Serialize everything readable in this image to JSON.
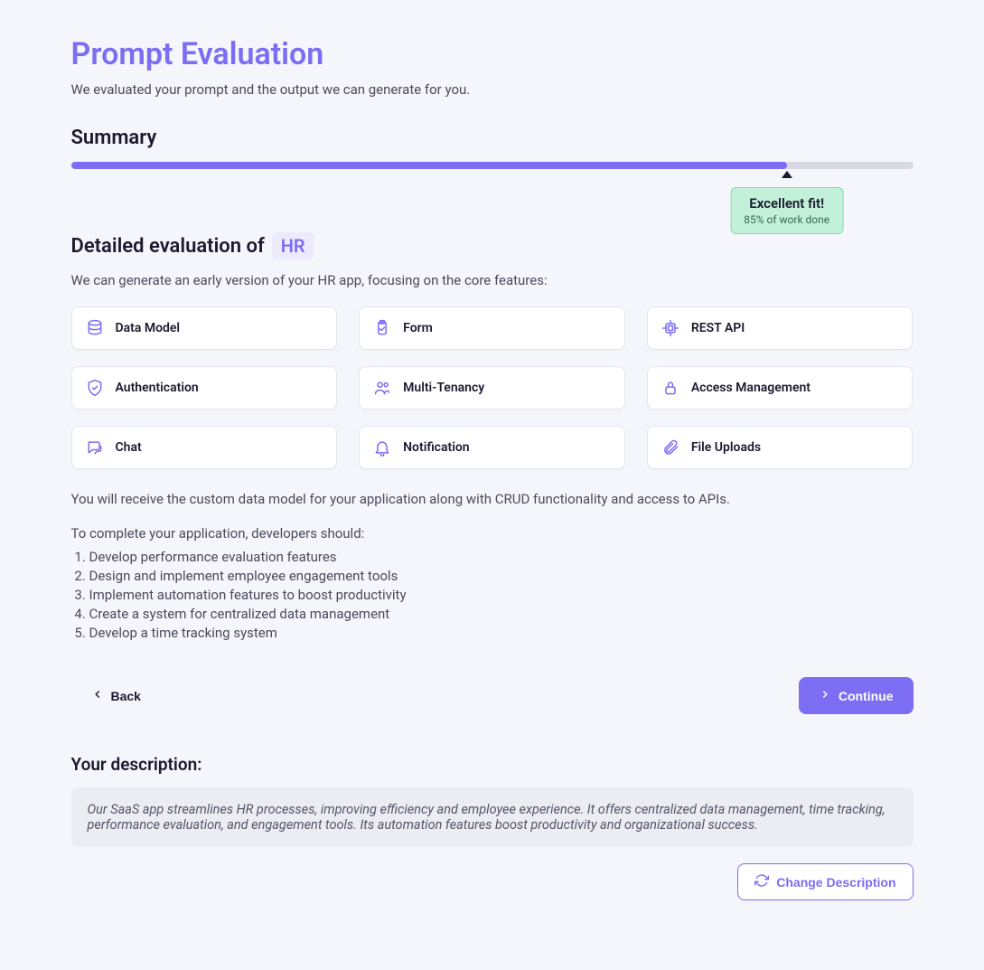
{
  "header": {
    "title": "Prompt Evaluation",
    "subtitle": "We evaluated your prompt and the output we can generate for you."
  },
  "summary": {
    "heading": "Summary",
    "progress_percent": 85,
    "badge_title": "Excellent fit!",
    "badge_sub": "85% of work done"
  },
  "detail": {
    "heading_prefix": "Detailed evaluation of",
    "chip": "HR",
    "intro": "We can generate an early version of your HR app, focusing on the core features:",
    "features": [
      {
        "icon": "database",
        "label": "Data Model"
      },
      {
        "icon": "clipboard",
        "label": "Form"
      },
      {
        "icon": "cpu",
        "label": "REST API"
      },
      {
        "icon": "shield",
        "label": "Authentication"
      },
      {
        "icon": "users",
        "label": "Multi-Tenancy"
      },
      {
        "icon": "lock",
        "label": "Access Management"
      },
      {
        "icon": "chat",
        "label": "Chat"
      },
      {
        "icon": "bell",
        "label": "Notification"
      },
      {
        "icon": "paperclip",
        "label": "File Uploads"
      }
    ],
    "para1": "You will receive the custom data model for your application along with CRUD functionality and access to APIs.",
    "para2": "To complete your application, developers should:",
    "steps": [
      "Develop performance evaluation features",
      "Design and implement employee engagement tools",
      "Implement automation features to boost productivity",
      "Create a system for centralized data management",
      "Develop a time tracking system"
    ]
  },
  "buttons": {
    "back": "Back",
    "continue": "Continue",
    "change_desc": "Change Description"
  },
  "description": {
    "heading": "Your description:",
    "text": "Our SaaS app streamlines HR processes, improving efficiency and employee experience. It offers centralized data management, time tracking, performance evaluation, and engagement tools. Its automation features boost productivity and organizational success."
  }
}
